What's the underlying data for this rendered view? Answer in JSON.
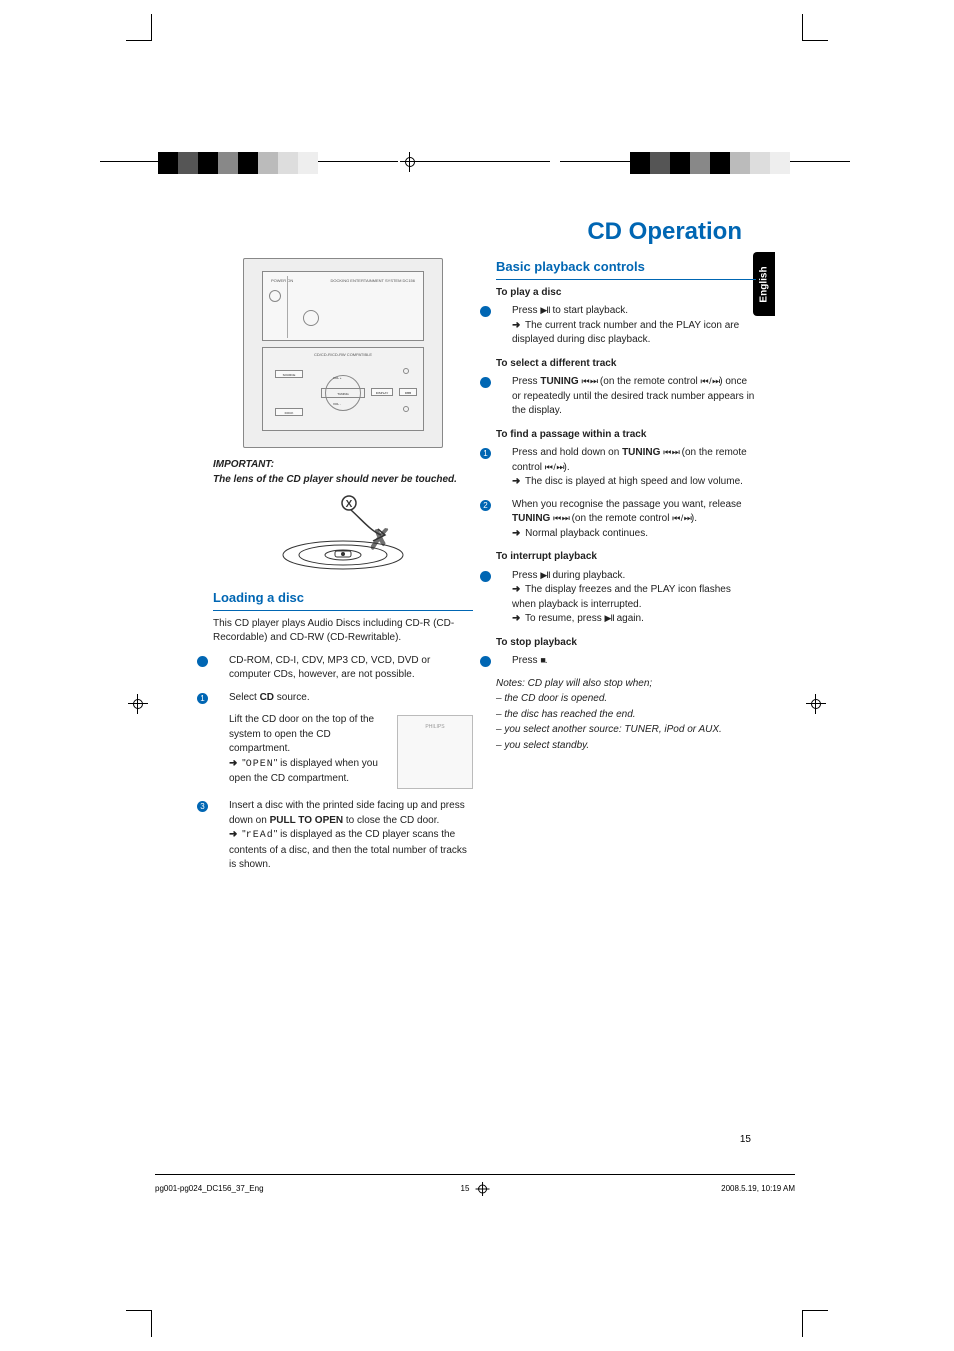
{
  "lang_tab": "English",
  "page_title": "CD Operation",
  "left": {
    "important_label": "IMPORTANT:",
    "important_text": "The lens of the CD player should never be touched.",
    "loading_head": "Loading a disc",
    "loading_intro": "This CD player plays Audio Discs including CD-R (CD-Recordable) and CD-RW (CD-Rewritable).",
    "loading_bullet": "CD-ROM, CD-I, CDV, MP3 CD, VCD, DVD or computer CDs, however, are not possible.",
    "step1_a": "Select ",
    "step1_b": "CD",
    "step1_c": " source.",
    "step2_a": "Lift the CD door on the top of the system to open the CD compartment.",
    "step2_res_a": "\"",
    "step2_res_seg": "OPEN",
    "step2_res_b": "\" is displayed when you open the CD compartment.",
    "step3_a": "Insert a disc with the printed side facing up and press down on ",
    "step3_b": "PULL TO OPEN",
    "step3_c": " to close the CD door.",
    "step3_res_a": "\"",
    "step3_res_seg": "rEAd",
    "step3_res_b": "\" is displayed as the CD player scans the contents of a disc, and then the total number of tracks is shown.",
    "device": {
      "power": "POWER ON",
      "header": "DOCKING ENTERTAINMENT SYSTEM DC156",
      "compat": "CD/CD-R/CD-RW COMPATIBLE",
      "src": "SOURCE",
      "volup": "VOL +",
      "voldn": "VOL -",
      "tuning": "TUNING",
      "display": "DISPLAY",
      "dbb": "DBB",
      "dock": "DOCK"
    }
  },
  "right": {
    "section_head": "Basic playback controls",
    "play_head": "To play a disc",
    "play_a": "Press ",
    "play_icon": "▶Ⅱ",
    "play_b": " to start playback.",
    "play_res": "The current track number and the PLAY icon are displayed during disc playback.",
    "select_head": "To select a different track",
    "select_a": "Press ",
    "select_b": "TUNING ",
    "select_icon1": "⏮ ⏭",
    "select_c": " (on the remote control ",
    "select_icon2": "⏮ / ⏭",
    "select_d": ") once or repeatedly until the desired track number appears in the display.",
    "find_head": "To find a passage within a track",
    "find1_a": "Press and hold down on ",
    "find1_b": "TUNING ",
    "find1_icon1": "⏮ ⏭",
    "find1_c": " (on the remote control ",
    "find1_icon2": "⏮ / ⏭",
    "find1_d": ").",
    "find1_res": "The disc is played at high speed and low volume.",
    "find2_a": "When you recognise the passage you want, release ",
    "find2_b": "TUNING ",
    "find2_icon1": "⏮ ⏭",
    "find2_c": " (on the remote control ",
    "find2_icon2": "⏮ / ⏭",
    "find2_d": ").",
    "find2_res": "Normal playback continues.",
    "int_head": "To interrupt playback",
    "int_a": "Press ",
    "int_icon": "▶Ⅱ",
    "int_b": " during playback.",
    "int_res1": "The display freezes and the PLAY icon flashes when playback is interrupted.",
    "int_res2a": "To resume, press ",
    "int_res2_icon": "▶Ⅱ",
    "int_res2b": " again.",
    "stop_head": "To stop playback",
    "stop_a": "Press ",
    "stop_icon": "■",
    "stop_b": ".",
    "notes_head": "Notes: CD play will also stop when;",
    "note1": "– the CD door is opened.",
    "note2": "– the disc has reached the end.",
    "note3": "– you select another source: TUNER, iPod or AUX.",
    "note4": "– you select standby."
  },
  "footer": {
    "left": "pg001-pg024_DC156_37_Eng",
    "mid": "15",
    "right": "2008.5.19, 10:19 AM"
  },
  "page_number": "15",
  "arrow": "➜"
}
